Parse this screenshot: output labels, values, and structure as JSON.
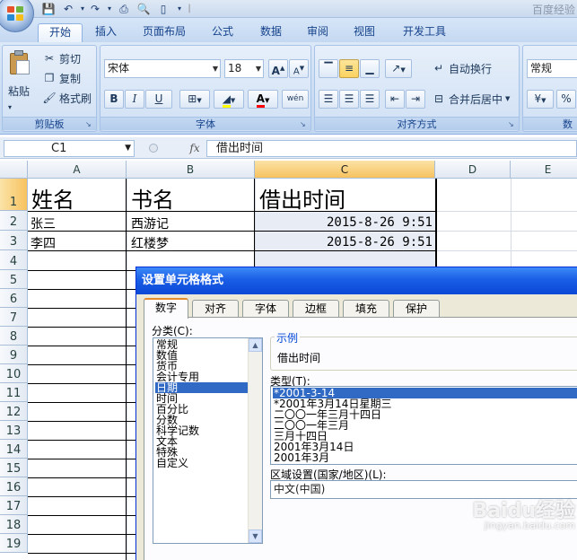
{
  "window": {
    "title_right": "百度经验"
  },
  "ribbon_tabs": [
    "开始",
    "插入",
    "页面布局",
    "公式",
    "数据",
    "审阅",
    "视图",
    "开发工具"
  ],
  "clipboard": {
    "paste": "粘贴",
    "cut": "剪切",
    "copy": "复制",
    "format_painter": "格式刷",
    "label": "剪贴板"
  },
  "font": {
    "name": "宋体",
    "size": "18",
    "label": "字体",
    "grow": "A",
    "shrink": "A",
    "bold": "B",
    "italic": "I",
    "underline": "U",
    "font_color_letter": "A",
    "phonetic": "wén"
  },
  "alignment": {
    "wrap_text": "自动换行",
    "merge_center": "合并后居中",
    "label": "对齐方式"
  },
  "number": {
    "format": "常规",
    "label": "数",
    "percent": "%"
  },
  "formula_bar": {
    "cell_ref": "C1",
    "fx": "fx",
    "content": "借出时间"
  },
  "columns": [
    "A",
    "B",
    "C",
    "D",
    "E"
  ],
  "rows": [
    "1",
    "2",
    "3",
    "4",
    "5",
    "6",
    "7",
    "8",
    "9",
    "10",
    "11",
    "12",
    "13",
    "14",
    "15",
    "16",
    "17",
    "18",
    "19"
  ],
  "cells": {
    "A1": "姓名",
    "B1": "书名",
    "C1": "借出时间",
    "A2": "张三",
    "B2": "西游记",
    "C2": "2015-8-26  9:51",
    "A3": "李四",
    "B3": "红楼梦",
    "C3": "2015-8-26  9:51"
  },
  "dialog": {
    "title": "设置单元格格式",
    "tabs": [
      "数字",
      "对齐",
      "字体",
      "边框",
      "填充",
      "保护"
    ],
    "category_label": "分类(C):",
    "categories": [
      "常规",
      "数值",
      "货币",
      "会计专用",
      "日期",
      "时间",
      "百分比",
      "分数",
      "科学记数",
      "文本",
      "特殊",
      "自定义"
    ],
    "selected_category": "日期",
    "sample_legend": "示例",
    "sample_value": "借出时间",
    "type_label": "类型(T):",
    "types": [
      "*2001-3-14",
      "*2001年3月14日星期三",
      "二〇〇一年三月十四日",
      "二〇〇一年三月",
      "三月十四日",
      "2001年3月14日",
      "2001年3月"
    ],
    "selected_type": "*2001-3-14",
    "locale_label": "区域设置(国家/地区)(L):",
    "locale_value": "中文(中国)"
  },
  "watermark": {
    "brand": "Baidu经验",
    "url": "jingyan.baidu.com"
  }
}
